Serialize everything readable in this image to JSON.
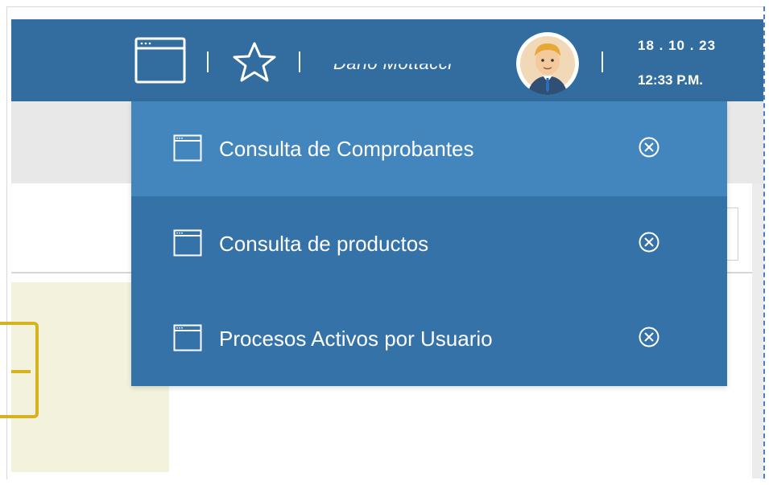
{
  "topbar": {
    "username": "Dario Mottacci",
    "date": "18 . 10 . 23",
    "time": "12:33 P.M.",
    "icons": [
      "window-icon",
      "star-icon",
      "avatar"
    ]
  },
  "open_windows_menu": {
    "items": [
      {
        "label": "Consulta de Comprobantes",
        "icon": "window-icon",
        "close_icon": "close-circle-icon",
        "active": true
      },
      {
        "label": "Consulta de productos",
        "icon": "window-icon",
        "close_icon": "close-circle-icon",
        "active": false
      },
      {
        "label": "Procesos Activos por Usuario",
        "icon": "window-icon",
        "close_icon": "close-circle-icon",
        "active": false
      }
    ]
  },
  "colors": {
    "topbar": "#336d9f",
    "menu": "#3572a8",
    "menu_active": "#4386bd",
    "grey_strip": "#e8e8e8",
    "cream_panel": "#f3f2dc",
    "yellow_card": "#d7b21f"
  }
}
